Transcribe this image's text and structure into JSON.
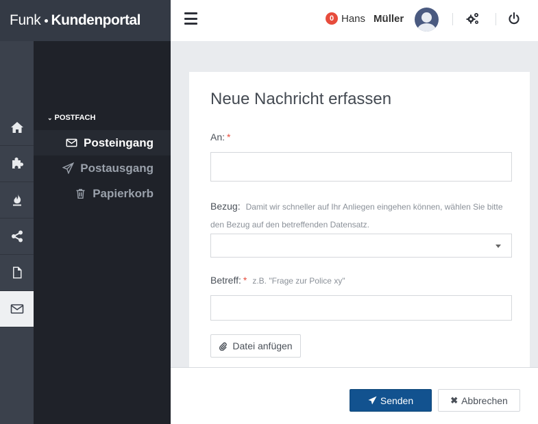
{
  "brand": {
    "part1": "Funk",
    "part2": "Kundenportal"
  },
  "rail": {
    "items": [
      {
        "icon": "home-icon"
      },
      {
        "icon": "puzzle-icon"
      },
      {
        "icon": "flame-icon"
      },
      {
        "icon": "share-icon"
      },
      {
        "icon": "file-icon"
      },
      {
        "icon": "envelope-icon",
        "active": true
      }
    ]
  },
  "subnav": {
    "section": "POSTFACH",
    "items": [
      {
        "label": "Posteingang",
        "icon": "envelope-icon",
        "active": true
      },
      {
        "label": "Postausgang",
        "icon": "paper-plane-icon"
      },
      {
        "label": "Papierkorb",
        "icon": "trash-icon"
      }
    ]
  },
  "topbar": {
    "notifications": "0",
    "user_first": "Hans",
    "user_last": "Müller"
  },
  "form": {
    "title": "Neue Nachricht erfassen",
    "to_label": "An:",
    "required_mark": "*",
    "to_value": "",
    "reference_label": "Bezug:",
    "reference_hint": "Damit wir schneller auf Ihr Anliegen eingehen können, wählen Sie bitte den Bezug auf den betreffenden Datensatz.",
    "reference_value": "",
    "subject_label": "Betreff:",
    "subject_hint": "z.B. \"Frage zur Police xy\"",
    "subject_value": "",
    "attach_label": "Datei anfügen"
  },
  "footer": {
    "send_label": "Senden",
    "cancel_label": "Abbrechen"
  },
  "colors": {
    "primary": "#12528f",
    "badge": "#e74c3c",
    "sidebar_dark": "#1f2229",
    "rail": "#3b414c"
  }
}
